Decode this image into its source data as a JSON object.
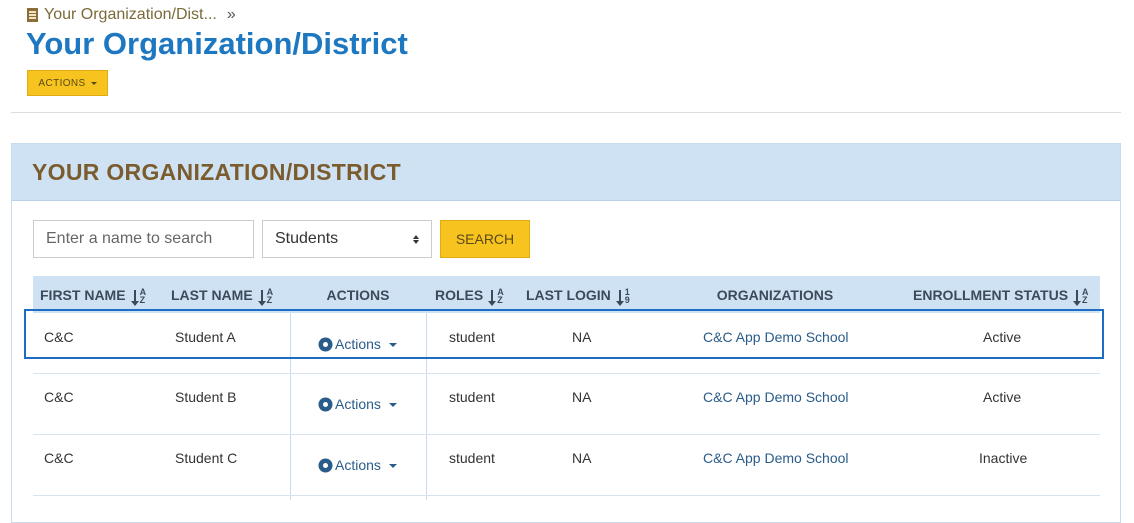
{
  "breadcrumb": {
    "text": "Your Organization/Dist...",
    "separator": "»"
  },
  "page_title": "Your Organization/District",
  "actions_button": "ACTIONS",
  "panel_title": "YOUR ORGANIZATION/DISTRICT",
  "search": {
    "placeholder": "Enter a name to search",
    "role_selected": "Students",
    "button": "SEARCH"
  },
  "columns": [
    "FIRST NAME",
    "LAST NAME",
    "ACTIONS",
    "ROLES",
    "LAST LOGIN",
    "ORGANIZATIONS",
    "ENROLLMENT STATUS"
  ],
  "sort_icons": {
    "az_top": "A",
    "az_bottom": "Z",
    "num_top": "1",
    "num_bottom": "9"
  },
  "rows": [
    {
      "first": "C&C",
      "last": "Student A",
      "actions": "Actions",
      "role": "student",
      "last_login": "NA",
      "org": "C&C App Demo School",
      "status": "Active"
    },
    {
      "first": "C&C",
      "last": "Student B",
      "actions": "Actions",
      "role": "student",
      "last_login": "NA",
      "org": "C&C App Demo School",
      "status": "Active"
    },
    {
      "first": "C&C",
      "last": "Student C",
      "actions": "Actions",
      "role": "student",
      "last_login": "NA",
      "org": "C&C App Demo School",
      "status": "Inactive"
    }
  ],
  "colors": {
    "accent": "#f7c31f",
    "title_blue": "#1d78c1",
    "header_bg": "#cfe2f3",
    "panel_title": "#7a5c2e",
    "highlight": "#1d6dc5"
  },
  "icons": {
    "breadcrumb": "building-icon",
    "row_actions": "gear-icon"
  }
}
